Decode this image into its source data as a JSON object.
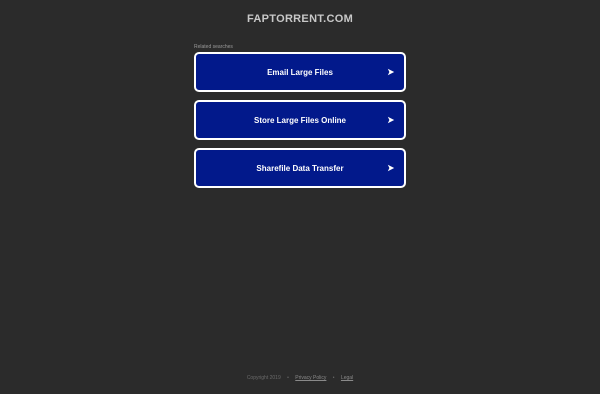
{
  "site": {
    "title": "FAPTORRENT.COM"
  },
  "related": {
    "label": "Related searches",
    "items": [
      {
        "label": "Email Large Files",
        "icon": "arrow-right-icon"
      },
      {
        "label": "Store Large Files Online",
        "icon": "arrow-right-icon"
      },
      {
        "label": "Sharefile Data Transfer",
        "icon": "arrow-right-icon"
      }
    ]
  },
  "footer": {
    "copyright": "Copyright 2019",
    "separator": "•",
    "privacy_label": "Privacy Policy",
    "legal_label": "Legal"
  },
  "colors": {
    "background": "#2b2b2b",
    "button_bg": "#02198b",
    "button_border": "#ffffff"
  }
}
